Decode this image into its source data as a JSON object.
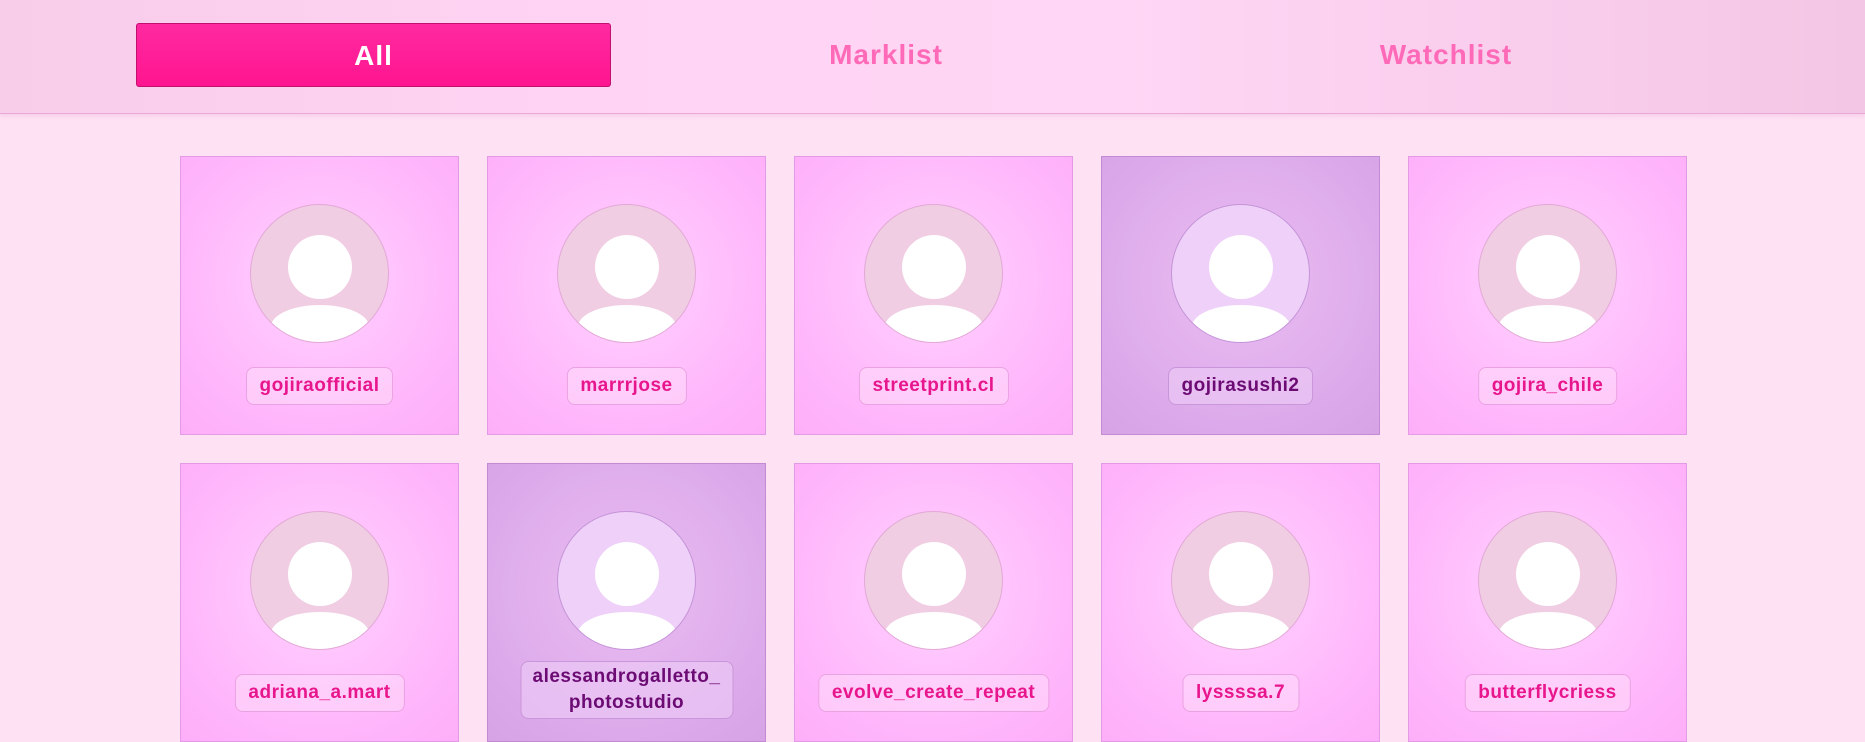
{
  "tabs": [
    {
      "label": "All",
      "active": true
    },
    {
      "label": "Marklist",
      "active": false
    },
    {
      "label": "Watchlist",
      "active": false
    }
  ],
  "colors": {
    "accent": "#ff1590",
    "inactive_tab": "#ff6ab8",
    "card": "#ffb6fb",
    "card_selected": "#dcaaea",
    "background": "#ffe1f4"
  },
  "profiles": [
    {
      "username": "gojiraofficial",
      "selected": false,
      "icon": "user-avatar-icon"
    },
    {
      "username": "marrrjose",
      "selected": false,
      "icon": "user-avatar-icon"
    },
    {
      "username": "streetprint.cl",
      "selected": false,
      "icon": "user-avatar-icon"
    },
    {
      "username": "gojirasushi2",
      "selected": true,
      "icon": "user-avatar-icon"
    },
    {
      "username": "gojira_chile",
      "selected": false,
      "icon": "user-avatar-icon"
    },
    {
      "username": "adriana_a.mart",
      "selected": false,
      "icon": "user-avatar-icon"
    },
    {
      "username": "alessandrogalletto_photostudio",
      "selected": true,
      "icon": "user-avatar-icon"
    },
    {
      "username": "evolve_create_repeat",
      "selected": false,
      "icon": "user-avatar-icon"
    },
    {
      "username": "lyssssa.7",
      "selected": false,
      "icon": "user-avatar-icon"
    },
    {
      "username": "butterflycriess",
      "selected": false,
      "icon": "user-avatar-icon"
    }
  ]
}
